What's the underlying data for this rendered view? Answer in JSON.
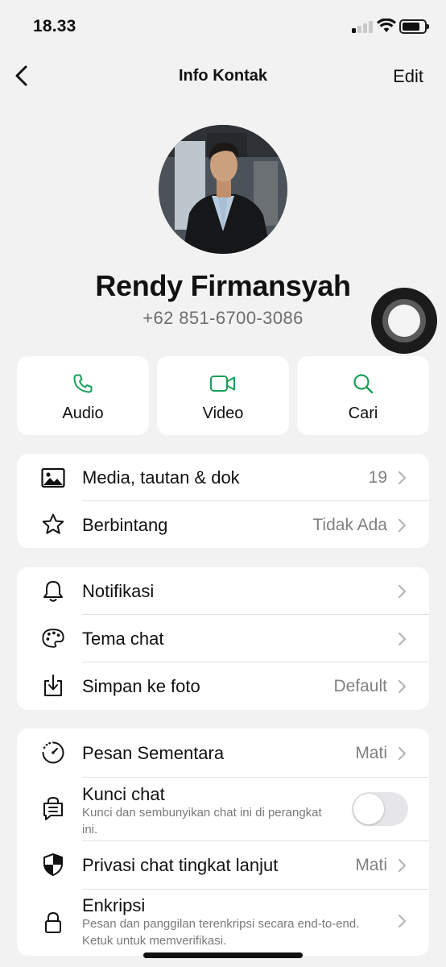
{
  "status_bar": {
    "time": "18.33"
  },
  "nav": {
    "title": "Info Kontak",
    "edit_label": "Edit"
  },
  "profile": {
    "name": "Rendy Firmansyah",
    "phone": "+62 851-6700-3086"
  },
  "actions": [
    {
      "label": "Audio",
      "icon": "phone-icon"
    },
    {
      "label": "Video",
      "icon": "video-icon"
    },
    {
      "label": "Cari",
      "icon": "search-icon"
    }
  ],
  "section1": [
    {
      "title": "Media, tautan & dok",
      "value": "19",
      "icon": "image-icon"
    },
    {
      "title": "Berbintang",
      "value": "Tidak Ada",
      "icon": "star-icon"
    }
  ],
  "section2": [
    {
      "title": "Notifikasi",
      "value": "",
      "icon": "bell-icon"
    },
    {
      "title": "Tema chat",
      "value": "",
      "icon": "palette-icon"
    },
    {
      "title": "Simpan ke foto",
      "value": "Default",
      "icon": "download-icon"
    }
  ],
  "section3": [
    {
      "title": "Pesan Sementara",
      "value": "Mati",
      "icon": "timer-icon"
    },
    {
      "title": "Kunci chat",
      "subtitle": "Kunci dan sembunyikan chat ini di perangkat ini.",
      "toggle_on": false,
      "icon": "chat-lock-icon"
    },
    {
      "title": "Privasi chat tingkat lanjut",
      "value": "Mati",
      "icon": "shield-icon"
    },
    {
      "title": "Enkripsi",
      "subtitle": "Pesan dan panggilan terenkripsi secara end-to-end. Ketuk untuk memverifikasi.",
      "icon": "lock-icon"
    }
  ],
  "colors": {
    "accent": "#1a9e58",
    "background": "#f2f2f2",
    "card": "#ffffff",
    "secondary_text": "#808080"
  }
}
